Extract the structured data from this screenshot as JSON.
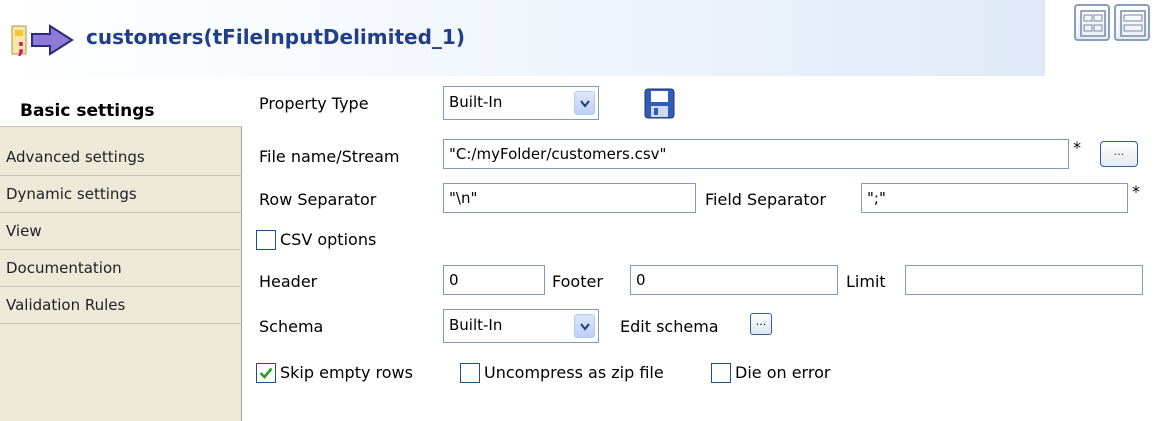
{
  "window": {
    "title": "customers(tFileInputDelimited_1)",
    "title_icon": "tfileinputdelimited-icon",
    "view_buttons": [
      "compact-view-icon",
      "table-view-icon"
    ]
  },
  "tabs": [
    {
      "label": "Basic settings",
      "active": true
    },
    {
      "label": "Advanced settings",
      "active": false
    },
    {
      "label": "Dynamic settings",
      "active": false
    },
    {
      "label": "View",
      "active": false
    },
    {
      "label": "Documentation",
      "active": false
    },
    {
      "label": "Validation Rules",
      "active": false
    }
  ],
  "form": {
    "property_type": {
      "label": "Property Type",
      "value": "Built-In"
    },
    "file_name": {
      "label": "File name/Stream",
      "value": "\"C:/myFolder/customers.csv\"",
      "required_mark": "*",
      "browse_label": "..."
    },
    "row_separator": {
      "label": "Row Separator",
      "value": "\"\\n\""
    },
    "field_separator": {
      "label": "Field Separator",
      "value": "\";\"",
      "required_mark": "*"
    },
    "csv_options": {
      "label": "CSV options",
      "checked": false
    },
    "header": {
      "label": "Header",
      "value": "0"
    },
    "footer": {
      "label": "Footer",
      "value": "0"
    },
    "limit": {
      "label": "Limit",
      "value": ""
    },
    "schema": {
      "label": "Schema",
      "value": "Built-In",
      "edit_label": "Edit schema",
      "edit_button": "..."
    },
    "skip_empty_rows": {
      "label": "Skip empty rows",
      "checked": true
    },
    "uncompress_zip": {
      "label": "Uncompress as zip file",
      "checked": false
    },
    "die_on_error": {
      "label": "Die on error",
      "checked": false
    }
  },
  "colors": {
    "title_text": "#1f3e8c",
    "tab_background": "#ece9d8",
    "field_border": "#7f9db9",
    "checkmark": "#21a121"
  }
}
